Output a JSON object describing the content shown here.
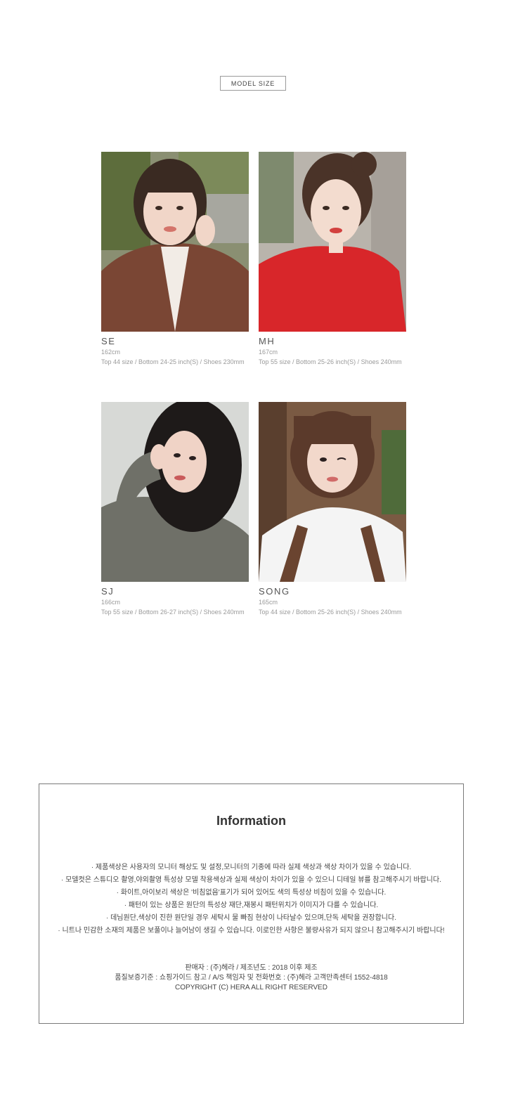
{
  "header": {
    "badge_label": "MODEL SIZE"
  },
  "models": [
    {
      "name": "SE",
      "height": "162cm",
      "sizes": "Top 44 size / Bottom 24-25 inch(S) / Shoes 230mm"
    },
    {
      "name": "MH",
      "height": "167cm",
      "sizes": "Top 55 size / Bottom 25-26 inch(S) / Shoes 240mm"
    },
    {
      "name": "SJ",
      "height": "166cm",
      "sizes": "Top 55 size / Bottom 26-27 inch(S) / Shoes 240mm"
    },
    {
      "name": "SONG",
      "height": "165cm",
      "sizes": "Top 44 size / Bottom 25-26 inch(S) / Shoes 240mm"
    }
  ],
  "info": {
    "title": "Information",
    "notes": [
      "· 제품색상은 사용자의 모니터 해상도 및 설정,모니터의 기종에 따라 실제 색상과 색상 차이가 있을 수 있습니다.",
      "· 모델컷은 스튜디오 촬영,야외촬영 특성상 모델 착용색상과 실제 색상이 차이가 있을 수 있으니 디테일 뷰를 참고해주시기 바랍니다.",
      "· 화이트,아이보리 색상은 '비침없음'표기가 되어 있어도 색의 특성상 비침이 있을 수 있습니다.",
      "· 패턴이 있는 상품은 원단의 특성상 재단,재봉시 패턴위치가 이미지가 다를 수 있습니다.",
      "· 데님원단,색상이 진한 원단일 경우 세탁시 물 빠짐 현상이 나타날수 있으며,단독 세탁을 권장합니다.",
      "· 니트나 민감한 소재의 제품은 보풀이나 늘어남이 생길 수 있습니다. 이로인한 사항은 불량사유가 되지 않으니 참고해주시기 바랍니다!"
    ],
    "seller_line": "판매자 : (주)헤라  / 제조년도 : 2018 이후 제조",
    "quality_line": "품질보증기준 : 쇼핑가이드 참고 / A/S 책임자 및 전화번호 : (주)헤라 고객만족센터 1552-4818",
    "copyright": "COPYRIGHT (C) HERA ALL RIGHT RESERVED"
  },
  "colors": {
    "photo_se_bg": "#6b7a4e",
    "photo_se_coat": "#7a4634",
    "photo_mh_bg": "#b9b4ac",
    "photo_mh_top": "#d8262a",
    "photo_sj_bg": "#d7d9d6",
    "photo_sj_top": "#6f7068",
    "photo_song_bg": "#7a5a43",
    "photo_song_top": "#f4f4f4"
  }
}
